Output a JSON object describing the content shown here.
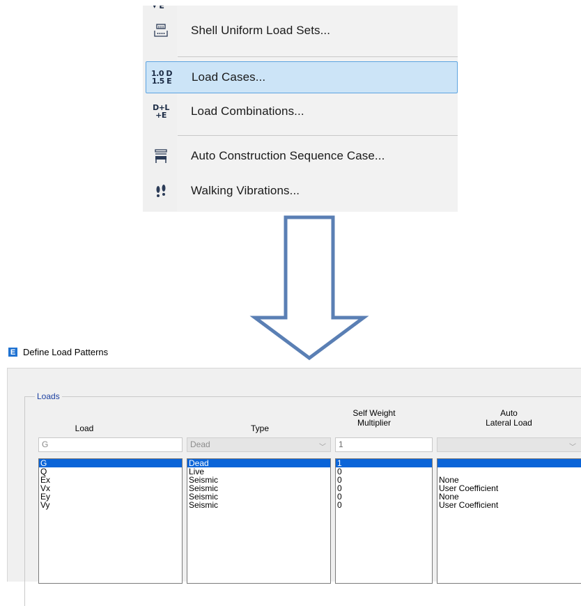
{
  "menu": {
    "items": [
      {
        "icon": "shell-uniform-load-icon",
        "label": "Shell Uniform Load Sets..."
      },
      {
        "icon_lines": [
          "1.0 D",
          "1.5 E"
        ],
        "label": "Load Cases...",
        "selected": true
      },
      {
        "icon_lines": [
          "D+L",
          "+E"
        ],
        "label": "Load Combinations..."
      },
      {
        "icon": "construction-sequence-icon",
        "label": "Auto Construction Sequence Case..."
      },
      {
        "icon": "footsteps-icon",
        "label": "Walking Vibrations..."
      }
    ]
  },
  "dialog": {
    "logo": "E",
    "title": "Define Load Patterns",
    "group_label": "Loads",
    "columns": {
      "load": "Load",
      "type": "Type",
      "self_weight_1": "Self Weight",
      "self_weight_2": "Multiplier",
      "auto_1": "Auto",
      "auto_2": "Lateral Load"
    },
    "inputs": {
      "load": "G",
      "type": "Dead",
      "self_weight": "1",
      "auto_lateral": ""
    },
    "rows": [
      {
        "load": "G",
        "type": "Dead",
        "multiplier": "1",
        "auto": ""
      },
      {
        "load": "Q",
        "type": "Live",
        "multiplier": "0",
        "auto": ""
      },
      {
        "load": "Ex",
        "type": "Seismic",
        "multiplier": "0",
        "auto": "None"
      },
      {
        "load": "Vx",
        "type": "Seismic",
        "multiplier": "0",
        "auto": "User Coefficient"
      },
      {
        "load": "Ey",
        "type": "Seismic",
        "multiplier": "0",
        "auto": "None"
      },
      {
        "load": "Vy",
        "type": "Seismic",
        "multiplier": "0",
        "auto": "User Coefficient"
      }
    ],
    "selected_row": 0
  },
  "colors": {
    "menu_highlight": "#cce4f7",
    "list_selection": "#0a64d8",
    "arrow_outline": "#5a7fb4",
    "group_label": "#1b3fa0"
  }
}
